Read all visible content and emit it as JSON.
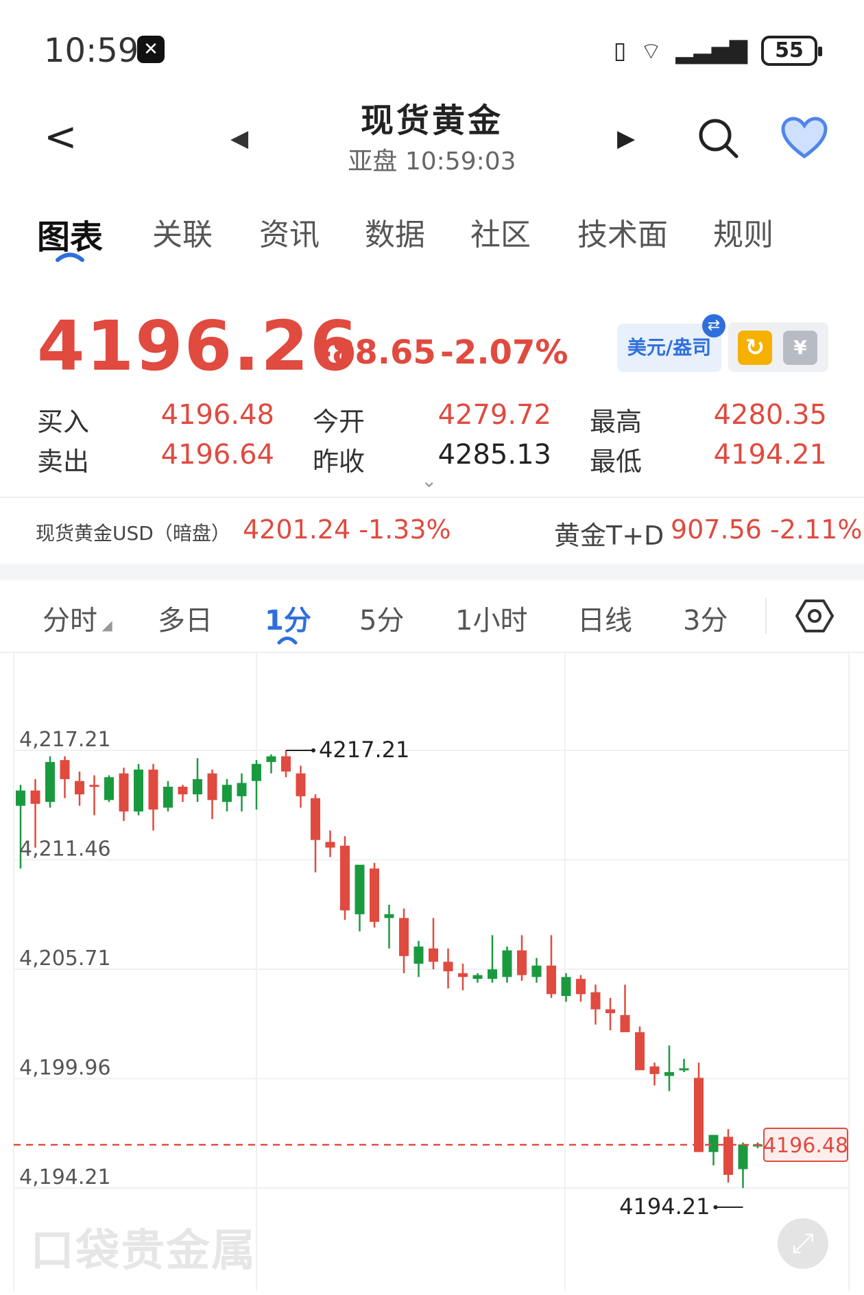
{
  "status": {
    "time": "10:59",
    "battery": "55"
  },
  "header": {
    "title": "现货黄金",
    "subtitle": "亚盘   10:59:03"
  },
  "tabs": [
    "图表",
    "关联",
    "资讯",
    "数据",
    "社区",
    "技术面",
    "规则"
  ],
  "quote": {
    "price": "4196.26",
    "change": "-88.65",
    "change_pct": "-2.07%",
    "currency_button": "美元/盎司",
    "buy_label": "买入",
    "buy": "4196.48",
    "sell_label": "卖出",
    "sell": "4196.64",
    "open_label": "今开",
    "open": "4279.72",
    "prev_close_label": "昨收",
    "prev_close": "4285.13",
    "high_label": "最高",
    "high": "4280.35",
    "low_label": "最低",
    "low": "4194.21"
  },
  "related": {
    "item1_name": "现货黄金USD（暗盘）",
    "item1_value": "4201.24  -1.33%",
    "item2_name": "黄金T+D",
    "item2_value": "907.56  -2.11%"
  },
  "periods": [
    "分时",
    "多日",
    "1分",
    "5分",
    "1小时",
    "日线",
    "3分"
  ],
  "active_period": "1分",
  "colors": {
    "up": "#1a9a3f",
    "down": "#e04a3f",
    "accent": "#2f6fdc"
  },
  "chart_data": {
    "type": "candlestick",
    "ylim": [
      4194.21,
      4217.21
    ],
    "y_ticks": [
      "4,217.21",
      "4,211.46",
      "4,205.71",
      "4,199.96",
      "4,194.21"
    ],
    "max_label": "4217.21",
    "min_label": "4194.21",
    "current_price_label": "4196.48",
    "current_price": 4196.48,
    "candles": [
      {
        "o": 4214.3,
        "h": 4215.4,
        "l": 4211.0,
        "c": 4215.1
      },
      {
        "o": 4215.1,
        "h": 4215.7,
        "l": 4212.1,
        "c": 4214.4
      },
      {
        "o": 4214.5,
        "h": 4216.9,
        "l": 4214.2,
        "c": 4216.6
      },
      {
        "o": 4216.7,
        "h": 4216.9,
        "l": 4214.7,
        "c": 4215.7
      },
      {
        "o": 4215.6,
        "h": 4216.1,
        "l": 4214.3,
        "c": 4214.9
      },
      {
        "o": 4215.4,
        "h": 4215.9,
        "l": 4213.8,
        "c": 4215.3
      },
      {
        "o": 4214.6,
        "h": 4215.9,
        "l": 4214.5,
        "c": 4215.8
      },
      {
        "o": 4216.0,
        "h": 4216.3,
        "l": 4213.5,
        "c": 4214.0
      },
      {
        "o": 4214.0,
        "h": 4216.5,
        "l": 4213.8,
        "c": 4216.2
      },
      {
        "o": 4216.2,
        "h": 4216.5,
        "l": 4213.0,
        "c": 4214.1
      },
      {
        "o": 4214.2,
        "h": 4215.6,
        "l": 4214.0,
        "c": 4215.3
      },
      {
        "o": 4215.3,
        "h": 4215.4,
        "l": 4214.5,
        "c": 4214.9
      },
      {
        "o": 4214.9,
        "h": 4216.8,
        "l": 4214.5,
        "c": 4215.7
      },
      {
        "o": 4216.0,
        "h": 4216.2,
        "l": 4213.6,
        "c": 4214.6
      },
      {
        "o": 4214.5,
        "h": 4215.7,
        "l": 4214.0,
        "c": 4215.4
      },
      {
        "o": 4214.8,
        "h": 4216.0,
        "l": 4214.0,
        "c": 4215.5
      },
      {
        "o": 4215.6,
        "h": 4216.7,
        "l": 4214.1,
        "c": 4216.5
      },
      {
        "o": 4216.6,
        "h": 4217.0,
        "l": 4216.0,
        "c": 4216.9
      },
      {
        "o": 4216.9,
        "h": 4217.21,
        "l": 4215.8,
        "c": 4216.1
      },
      {
        "o": 4216.0,
        "h": 4216.4,
        "l": 4214.2,
        "c": 4214.8
      },
      {
        "o": 4214.7,
        "h": 4214.9,
        "l": 4210.8,
        "c": 4212.5
      },
      {
        "o": 4212.4,
        "h": 4213.0,
        "l": 4211.6,
        "c": 4212.1
      },
      {
        "o": 4212.2,
        "h": 4212.7,
        "l": 4208.3,
        "c": 4208.8
      },
      {
        "o": 4208.6,
        "h": 4209.1,
        "l": 4207.7,
        "c": 4211.2
      },
      {
        "o": 4211.0,
        "h": 4211.3,
        "l": 4207.9,
        "c": 4208.2
      },
      {
        "o": 4208.4,
        "h": 4209.1,
        "l": 4206.8,
        "c": 4208.6
      },
      {
        "o": 4208.4,
        "h": 4208.9,
        "l": 4205.5,
        "c": 4206.4
      },
      {
        "o": 4206.0,
        "h": 4207.2,
        "l": 4205.3,
        "c": 4206.9
      },
      {
        "o": 4206.8,
        "h": 4208.4,
        "l": 4205.7,
        "c": 4206.1
      },
      {
        "o": 4206.1,
        "h": 4206.8,
        "l": 4204.7,
        "c": 4205.6
      },
      {
        "o": 4205.5,
        "h": 4206.0,
        "l": 4204.6,
        "c": 4205.3
      },
      {
        "o": 4205.2,
        "h": 4205.5,
        "l": 4205.0,
        "c": 4205.4
      },
      {
        "o": 4205.2,
        "h": 4207.5,
        "l": 4205.0,
        "c": 4205.7
      },
      {
        "o": 4205.3,
        "h": 4206.9,
        "l": 4205.0,
        "c": 4206.7
      },
      {
        "o": 4206.7,
        "h": 4207.5,
        "l": 4205.1,
        "c": 4205.4
      },
      {
        "o": 4205.3,
        "h": 4206.3,
        "l": 4205.0,
        "c": 4205.9
      },
      {
        "o": 4205.9,
        "h": 4207.5,
        "l": 4204.2,
        "c": 4204.4
      },
      {
        "o": 4204.3,
        "h": 4205.5,
        "l": 4204.0,
        "c": 4205.3
      },
      {
        "o": 4205.2,
        "h": 4205.4,
        "l": 4204.0,
        "c": 4204.4
      },
      {
        "o": 4204.5,
        "h": 4204.9,
        "l": 4202.8,
        "c": 4203.6
      },
      {
        "o": 4203.6,
        "h": 4204.2,
        "l": 4202.5,
        "c": 4203.4
      },
      {
        "o": 4203.3,
        "h": 4204.9,
        "l": 4202.5,
        "c": 4202.4
      },
      {
        "o": 4202.4,
        "h": 4202.7,
        "l": 4200.5,
        "c": 4200.4
      },
      {
        "o": 4200.6,
        "h": 4200.8,
        "l": 4199.6,
        "c": 4200.2
      },
      {
        "o": 4200.1,
        "h": 4201.7,
        "l": 4199.3,
        "c": 4200.3
      },
      {
        "o": 4200.5,
        "h": 4201.0,
        "l": 4200.3,
        "c": 4200.5
      },
      {
        "o": 4200.0,
        "h": 4200.8,
        "l": 4196.1,
        "c": 4196.1
      },
      {
        "o": 4196.1,
        "h": 4197.0,
        "l": 4195.4,
        "c": 4197.0
      },
      {
        "o": 4196.9,
        "h": 4197.3,
        "l": 4194.5,
        "c": 4194.9
      },
      {
        "o": 4195.2,
        "h": 4196.6,
        "l": 4194.21,
        "c": 4196.5
      },
      {
        "o": 4196.4,
        "h": 4196.6,
        "l": 4196.3,
        "c": 4196.5
      }
    ]
  }
}
